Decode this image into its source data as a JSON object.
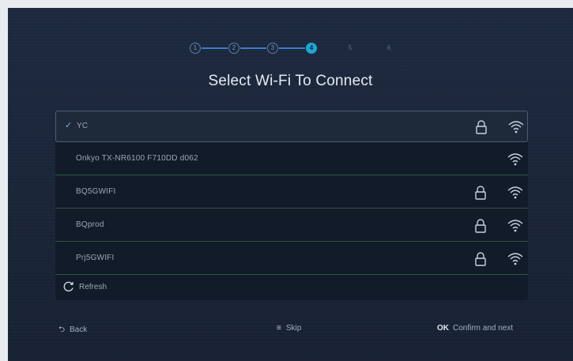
{
  "stepper": {
    "steps": [
      "1",
      "2",
      "3",
      "4",
      "5",
      "6"
    ],
    "current": 4
  },
  "title": "Select Wi-Fi To Connect",
  "networks": [
    {
      "ssid": "YC",
      "secured": true,
      "selected": true
    },
    {
      "ssid": "Onkyo TX-NR6100 F710DD d062",
      "secured": false,
      "selected": false
    },
    {
      "ssid": "BQ5GWIFI",
      "secured": true,
      "selected": false
    },
    {
      "ssid": "BQprod",
      "secured": true,
      "selected": false
    },
    {
      "ssid": "Prj5GWIFI",
      "secured": true,
      "selected": false
    }
  ],
  "refresh_label": "Refresh",
  "footer": {
    "back_label": "Back",
    "skip_label": "Skip",
    "ok_key": "OK",
    "confirm_label": "Confirm and next"
  },
  "colors": {
    "background": "#1d2a3e",
    "accent": "#1aa7d8",
    "list_bg": "#121b29"
  },
  "icons": {
    "selected": "check-icon",
    "secured": "lock-icon",
    "signal": "wifi-icon",
    "refresh": "refresh-icon",
    "back": "back-icon",
    "skip": "menu-icon"
  }
}
